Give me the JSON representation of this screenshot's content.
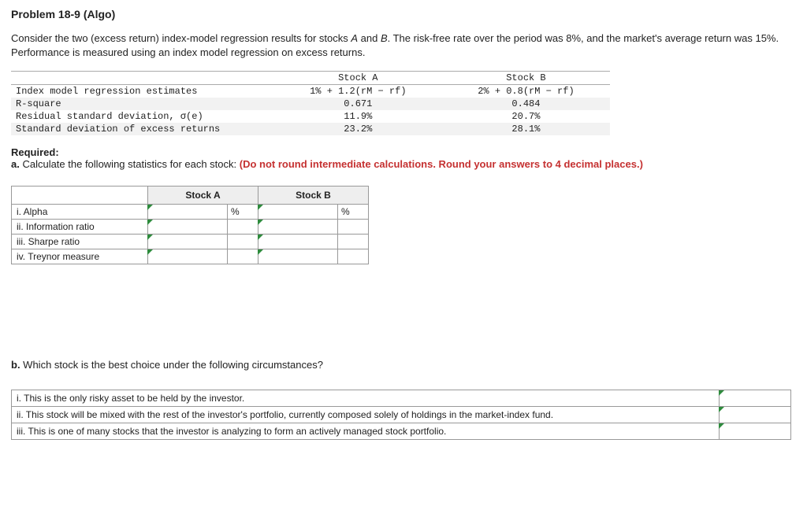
{
  "title": "Problem 18-9 (Algo)",
  "intro_1": "Consider the two (excess return) index-model regression results for stocks ",
  "intro_a": "A",
  "intro_2": " and ",
  "intro_b": "B",
  "intro_3": ". The risk-free rate over the period was 8%, and the market's average return was 15%. Performance is measured using an index model regression on excess returns.",
  "dt": {
    "h_a": "Stock A",
    "h_b": "Stock B",
    "rows": [
      {
        "label": "Index model regression estimates",
        "a": "1% + 1.2(rM − rf)",
        "b": "2% + 0.8(rM − rf)"
      },
      {
        "label": "R-square",
        "a": "0.671",
        "b": "0.484"
      },
      {
        "label": "Residual standard deviation, σ(e)",
        "a": "11.9%",
        "b": "20.7%"
      },
      {
        "label": "Standard deviation of excess returns",
        "a": "23.2%",
        "b": "28.1%"
      }
    ]
  },
  "req_h": "Required:",
  "req_a1": "a.",
  "req_a2": " Calculate the following statistics for each stock: ",
  "req_red": "(Do not round intermediate calculations. Round your answers to 4 decimal places.)",
  "ans": {
    "h_a": "Stock A",
    "h_b": "Stock B",
    "rows": [
      "i. Alpha",
      "ii. Information ratio",
      "iii. Sharpe ratio",
      "iv. Treynor measure"
    ],
    "pct": "%"
  },
  "partb_1": "b.",
  "partb_2": " Which stock is the best choice under the following circumstances?",
  "btab": [
    "i. This is the only risky asset to be held by the investor.",
    "ii. This stock will be mixed with the rest of the investor's portfolio, currently composed solely of holdings in the market-index fund.",
    "iii. This is one of many stocks that the investor is analyzing to form an actively managed stock portfolio."
  ]
}
